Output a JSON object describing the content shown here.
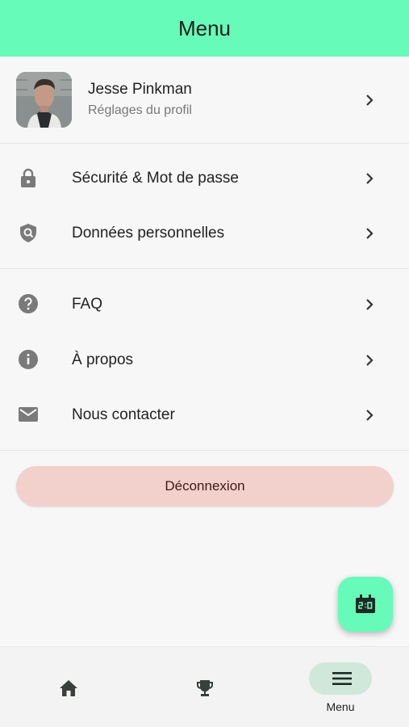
{
  "app_bar": {
    "title": "Menu"
  },
  "profile": {
    "name": "Jesse Pinkman",
    "subtitle": "Réglages du profil"
  },
  "sections": {
    "account": [
      {
        "label": "Sécurité & Mot de passe",
        "icon": "lock-icon"
      },
      {
        "label": "Données personnelles",
        "icon": "shield-search-icon"
      }
    ],
    "info": [
      {
        "label": "FAQ",
        "icon": "help-circle-icon"
      },
      {
        "label": "À propos",
        "icon": "info-icon"
      },
      {
        "label": "Nous contacter",
        "icon": "mail-icon"
      }
    ]
  },
  "logout": {
    "label": "Déconnexion"
  },
  "fab": {
    "icon": "scoreboard-icon"
  },
  "bottom_nav": {
    "items": [
      {
        "icon": "home-icon",
        "label": ""
      },
      {
        "icon": "trophy-icon",
        "label": ""
      },
      {
        "icon": "menu-icon",
        "label": "Menu",
        "active": true
      }
    ]
  },
  "colors": {
    "accent": "#66fbb9",
    "logout_bg": "#f2d1cc",
    "active_pill": "#cfe8d9",
    "icon_gray": "#7a7a7a"
  }
}
